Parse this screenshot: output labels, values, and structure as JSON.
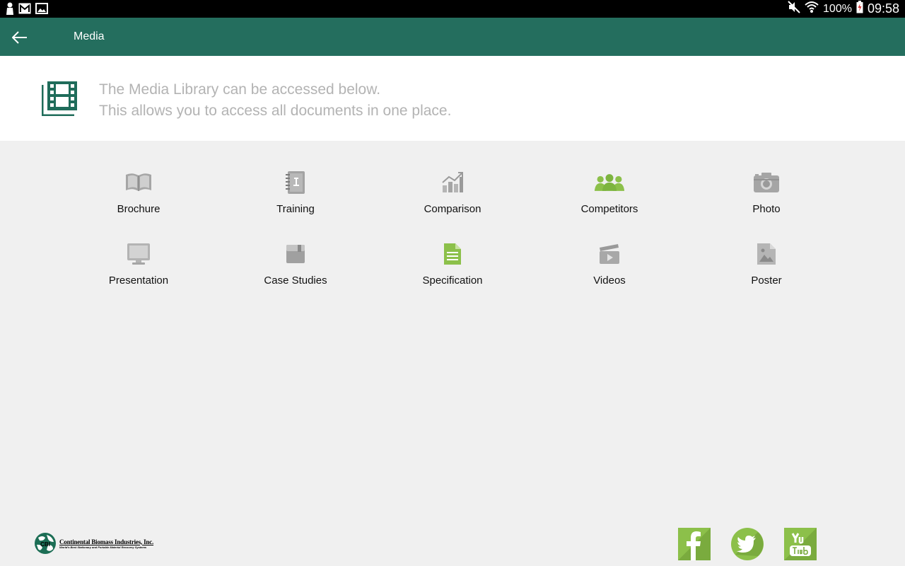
{
  "status_bar": {
    "battery": "100%",
    "time": "09:58"
  },
  "app_bar": {
    "title": "Media"
  },
  "intro": {
    "line1": "The Media Library can be accessed below.",
    "line2": "This allows you to access all documents in one place."
  },
  "categories": [
    {
      "label": "Brochure",
      "icon": "book-icon"
    },
    {
      "label": "Training",
      "icon": "notebook-icon"
    },
    {
      "label": "Comparison",
      "icon": "chart-icon"
    },
    {
      "label": "Competitors",
      "icon": "people-icon"
    },
    {
      "label": "Photo",
      "icon": "camera-icon"
    },
    {
      "label": "Presentation",
      "icon": "monitor-icon"
    },
    {
      "label": "Case Studies",
      "icon": "folder-icon"
    },
    {
      "label": "Specification",
      "icon": "document-icon"
    },
    {
      "label": "Videos",
      "icon": "clapperboard-icon"
    },
    {
      "label": "Poster",
      "icon": "image-icon"
    }
  ],
  "footer": {
    "company_name": "Continental Biomass Industries, Inc.",
    "company_tagline": "World's Best Stationary and Portable Material Recovery Systems",
    "logo_initials": "CBI",
    "social": [
      "facebook",
      "twitter",
      "youtube"
    ]
  },
  "colors": {
    "app_bar": "#246e5e",
    "accent_green": "#8cc04a",
    "icon_gray": "#9a9a9a",
    "intro_text": "#b3b3b3"
  }
}
